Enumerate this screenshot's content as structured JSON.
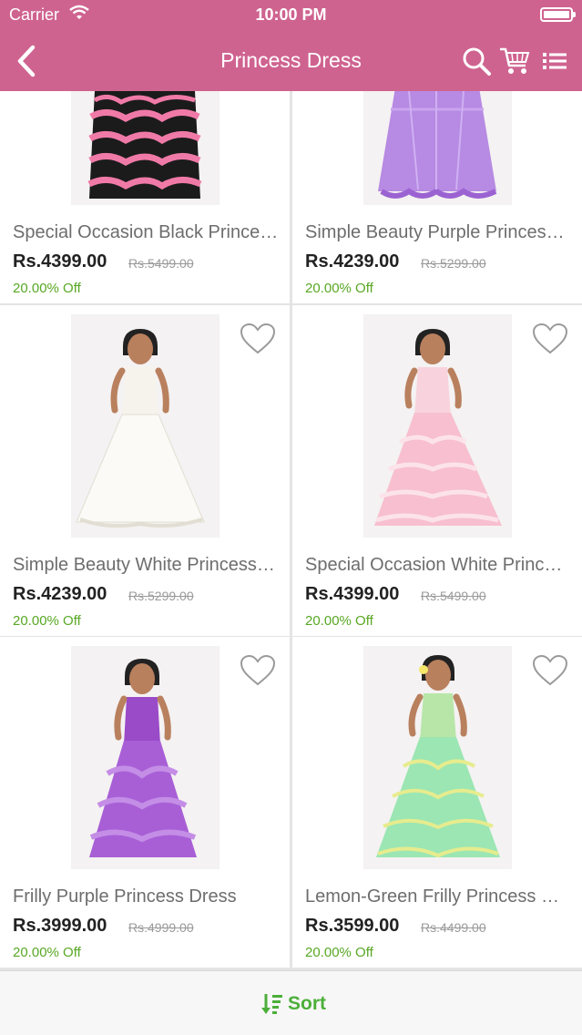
{
  "status_bar": {
    "carrier": "Carrier",
    "time": "10:00 PM"
  },
  "nav": {
    "title": "Princess Dress"
  },
  "products": [
    {
      "name": "Special Occasion Black Princess Dress",
      "price": "Rs.4399.00",
      "mrp": "Rs.5499.00",
      "discount": "20.00% Off",
      "dress_color": "black-pink"
    },
    {
      "name": "Simple Beauty Purple Princess Dress",
      "price": "Rs.4239.00",
      "mrp": "Rs.5299.00",
      "discount": "20.00% Off",
      "dress_color": "purple"
    },
    {
      "name": "Simple Beauty White Princess Dress",
      "price": "Rs.4239.00",
      "mrp": "Rs.5299.00",
      "discount": "20.00% Off",
      "dress_color": "white"
    },
    {
      "name": "Special Occasion White Princess Dress",
      "price": "Rs.4399.00",
      "mrp": "Rs.5499.00",
      "discount": "20.00% Off",
      "dress_color": "pink"
    },
    {
      "name": "Frilly Purple Princess Dress",
      "price": "Rs.3999.00",
      "mrp": "Rs.4999.00",
      "discount": "20.00% Off",
      "dress_color": "violet"
    },
    {
      "name": "Lemon-Green Frilly Princess Dress",
      "price": "Rs.3599.00",
      "mrp": "Rs.4499.00",
      "discount": "20.00% Off",
      "dress_color": "lemon-green"
    }
  ],
  "bottom_bar": {
    "sort_label": "Sort"
  },
  "colors": {
    "accent": "#cf6390",
    "discount_green": "#58a824",
    "sort_green": "#4caf3a"
  }
}
